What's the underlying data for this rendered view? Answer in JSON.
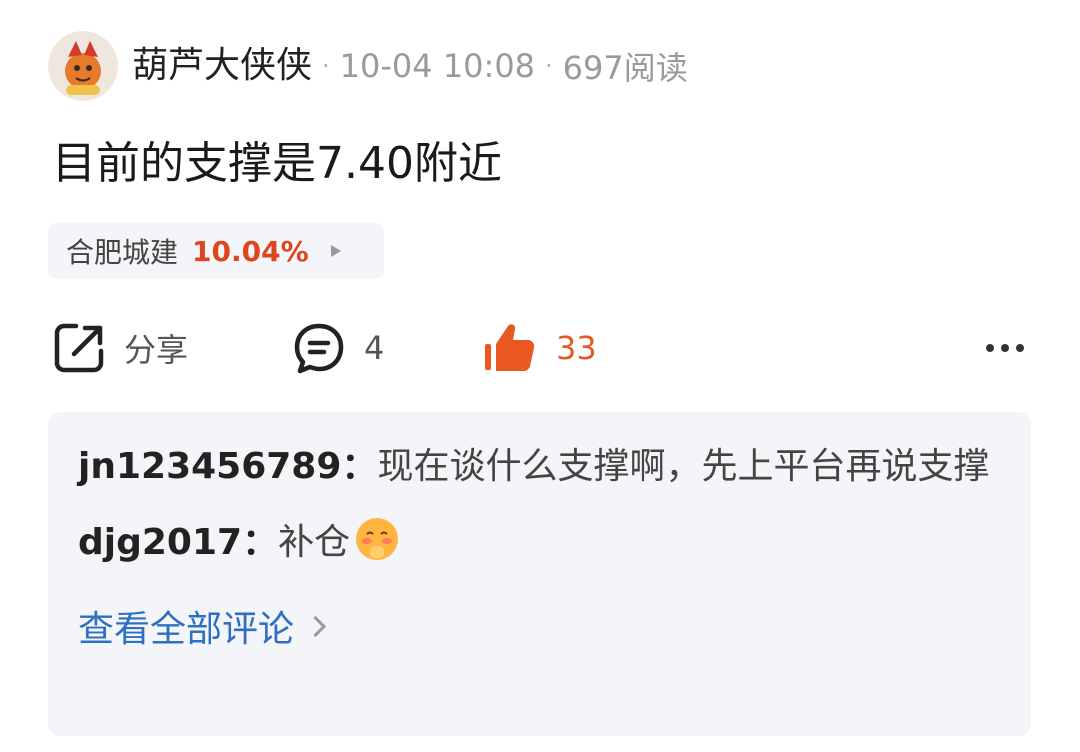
{
  "post": {
    "author": "葫芦大侠侠",
    "date": "10-04 10:08",
    "reads": "697阅读",
    "text": "目前的支撑是7.40附近"
  },
  "stock": {
    "name": "合肥城建",
    "change": "10.04%"
  },
  "actions": {
    "share_label": "分享",
    "comment_count": "4",
    "like_count": "33"
  },
  "comments": [
    {
      "user": "jn123456789",
      "sep": "：",
      "text": "现在谈什么支撑啊，先上平台再说支撑"
    },
    {
      "user": "djg2017",
      "sep": "：",
      "text": "补仓"
    }
  ],
  "view_all": "查看全部评论",
  "colors": {
    "accent": "#e8581f",
    "link": "#2f6fc1",
    "box_bg": "#f4f5f8"
  },
  "icons": [
    "avatar-image",
    "share-icon",
    "comment-icon",
    "thumbs-up-icon",
    "more-icon",
    "blush-emoji",
    "chevron-right-icon"
  ]
}
